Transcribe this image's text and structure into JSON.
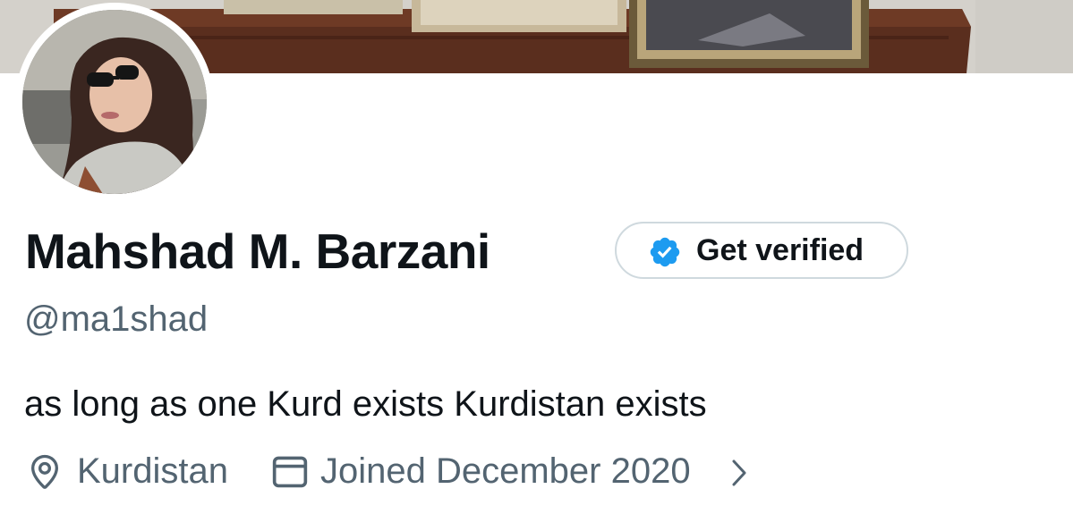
{
  "profile": {
    "display_name": "Mahshad M. Barzani",
    "handle": "@ma1shad",
    "bio": "as long as one Kurd exists Kurdistan exists",
    "location": "Kurdistan",
    "joined": "Joined December 2020"
  },
  "verify_button": {
    "label": "Get verified",
    "icon": "verified-badge-icon",
    "badge_color": "#1d9bf0"
  },
  "icons": {
    "location": "location-pin-icon",
    "calendar": "calendar-icon",
    "chevron": "chevron-right-icon"
  },
  "colors": {
    "primary_text": "#0f1419",
    "secondary_text": "#536471",
    "border": "#cfd9de"
  }
}
